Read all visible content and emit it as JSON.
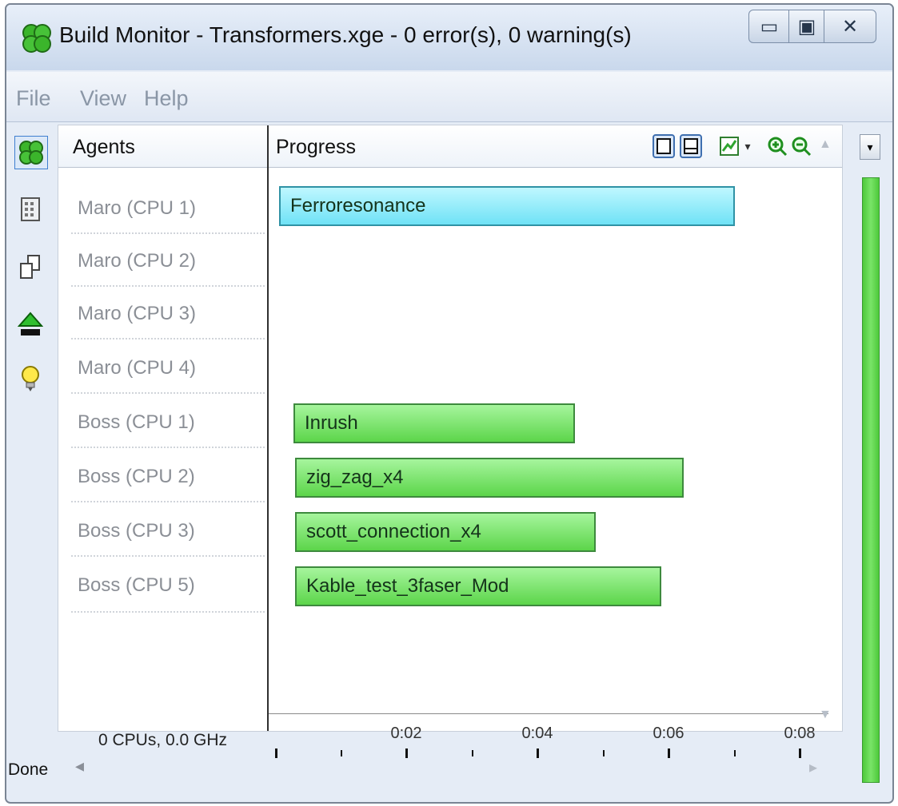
{
  "window": {
    "title": "Build Monitor - Transformers.xge - 0 error(s), 0 warning(s)",
    "controls": {
      "minimize": "minimize-icon",
      "maximize": "maximize-icon",
      "close": "close-icon"
    }
  },
  "menu": {
    "file": "File",
    "view": "View",
    "help": "Help"
  },
  "left_toolbar": [
    "monitor-icon",
    "calculator-icon",
    "copy-icon",
    "tree-icon",
    "lightbulb-icon"
  ],
  "grid": {
    "header_agents": "Agents",
    "header_progress": "Progress",
    "agents": [
      "Maro (CPU 1)",
      "Maro (CPU 2)",
      "Maro (CPU 3)",
      "Maro (CPU 4)",
      "Boss (CPU 1)",
      "Boss (CPU 2)",
      "Boss (CPU 3)",
      "Boss (CPU 5)"
    ],
    "tasks": [
      {
        "label": "Ferroresonance"
      },
      {
        "label": "Inrush"
      },
      {
        "label": "zig_zag_x4"
      },
      {
        "label": "scott_connection_x4"
      },
      {
        "label": "Kable_test_3faser_Mod"
      }
    ],
    "cpu_summary": "0 CPUs, 0.0 GHz",
    "time_ticks": [
      "0:02",
      "0:04",
      "0:06",
      "0:08"
    ]
  },
  "toolbar_right": [
    "layout-vertical-icon",
    "layout-horizontal-icon",
    "chart-icon",
    "dropdown-arrow-icon",
    "zoom-in-icon",
    "zoom-out-icon"
  ],
  "status": {
    "text": "Done"
  },
  "colors": {
    "task_green": "#5cd54a",
    "task_cyan": "#6fe2f6",
    "scroll_green": "#4dc93b"
  }
}
